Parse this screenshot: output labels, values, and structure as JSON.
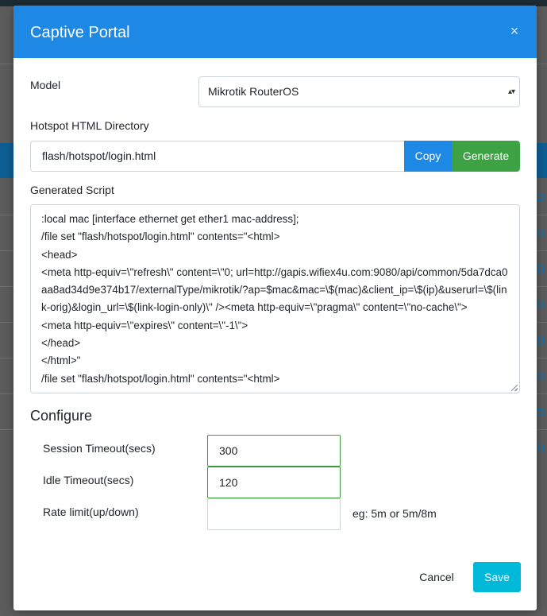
{
  "background": {
    "row_marker": "D"
  },
  "modal": {
    "title": "Captive Portal",
    "close_glyph": "×",
    "model_label": "Model",
    "model_value": "Mikrotik RouterOS",
    "model_caret": "▴▾",
    "directory_label": "Hotspot HTML Directory",
    "directory_value": "flash/hotspot/login.html",
    "copy_label": "Copy",
    "generate_label": "Generate",
    "script_label": "Generated Script",
    "script_text": ":local mac [interface ethernet get ether1 mac-address];\n/file set \"flash/hotspot/login.html\" contents=\"<html>\n<head>\n<meta http-equiv=\\\"refresh\\\" content=\\\"0; url=http://gapis.wifiex4u.com:9080/api/common/5da7dca0aa8ad34d9e374b17/externalType/mikrotik/?ap=$mac&mac=\\$(mac)&client_ip=\\$(ip)&userurl=\\$(link-orig)&login_url=\\$(link-login-only)\\\" /><meta http-equiv=\\\"pragma\\\" content=\\\"no-cache\\\">\n<meta http-equiv=\\\"expires\\\" content=\\\"-1\\\">\n</head>\n</html>\"\n/file set \"flash/hotspot/login.html\" contents=\"<html>",
    "configure_title": "Configure",
    "session_timeout_label": "Session Timeout(secs)",
    "session_timeout_value": "300",
    "idle_timeout_label": "Idle Timeout(secs)",
    "idle_timeout_value": "120",
    "rate_limit_label": "Rate limit(up/down)",
    "rate_limit_value": "",
    "rate_limit_hint": "eg: 5m or 5m/8m",
    "cancel_label": "Cancel",
    "save_label": "Save"
  },
  "colors": {
    "header": "#1e88e5",
    "copy_button": "#1e88e5",
    "generate_button": "#3ca244",
    "save_button": "#00b8d8",
    "focused_border": "#3c9a3c"
  }
}
